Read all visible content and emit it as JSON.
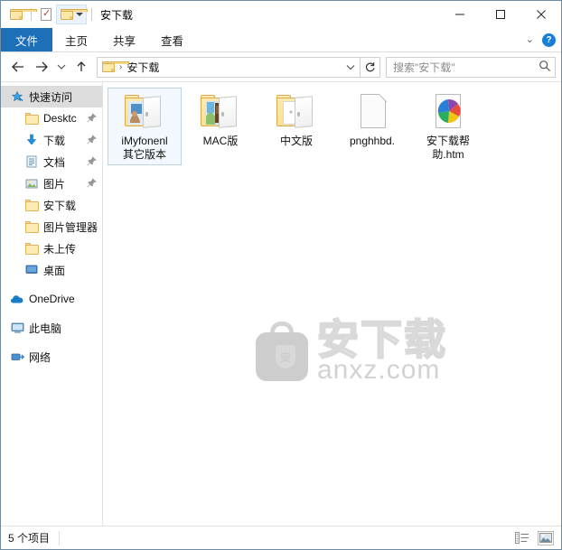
{
  "window": {
    "title": "安下载",
    "quick_access": [
      {
        "name": "folder-icon",
        "label": ""
      },
      {
        "name": "properties-icon",
        "label": ""
      },
      {
        "name": "new-folder-dropdown",
        "label": ""
      }
    ],
    "controls": {
      "minimize": "–",
      "maximize": "□",
      "close": "✕"
    }
  },
  "ribbon": {
    "tabs": [
      {
        "label": "文件",
        "active": true
      },
      {
        "label": "主页",
        "active": false
      },
      {
        "label": "共享",
        "active": false
      },
      {
        "label": "查看",
        "active": false
      }
    ],
    "expand_label": "⌄",
    "help_label": "?"
  },
  "address": {
    "back_title": "后退",
    "forward_title": "前进",
    "recent_title": "最近使用的位置",
    "up_title": "上移到",
    "breadcrumb": "安下载",
    "breadcrumb_sep": "›",
    "dropdown_label": "⌄",
    "refresh_label": "↻"
  },
  "search": {
    "placeholder": "搜索\"安下载\"",
    "icon": "search-icon"
  },
  "sidebar": {
    "items": [
      {
        "label": "快速访问",
        "icon": "star-pin-icon",
        "selected": true,
        "indent": false,
        "pinned": false
      },
      {
        "label": "Desktc",
        "icon": "folder-icon",
        "selected": false,
        "indent": true,
        "pinned": true
      },
      {
        "label": "下载",
        "icon": "download-icon",
        "selected": false,
        "indent": true,
        "pinned": true
      },
      {
        "label": "文档",
        "icon": "documents-icon",
        "selected": false,
        "indent": true,
        "pinned": true
      },
      {
        "label": "图片",
        "icon": "pictures-icon",
        "selected": false,
        "indent": true,
        "pinned": true
      },
      {
        "label": "安下载",
        "icon": "folder-icon",
        "selected": false,
        "indent": true,
        "pinned": false
      },
      {
        "label": "图片管理器",
        "icon": "folder-icon",
        "selected": false,
        "indent": true,
        "pinned": false
      },
      {
        "label": "未上传",
        "icon": "folder-icon",
        "selected": false,
        "indent": true,
        "pinned": false
      },
      {
        "label": "桌面",
        "icon": "desktop-icon",
        "selected": false,
        "indent": true,
        "pinned": false
      },
      {
        "label": "OneDrive",
        "icon": "onedrive-cloud-icon",
        "selected": false,
        "indent": false,
        "pinned": false
      },
      {
        "label": "此电脑",
        "icon": "this-pc-icon",
        "selected": false,
        "indent": false,
        "pinned": false
      },
      {
        "label": "网络",
        "icon": "network-icon",
        "selected": false,
        "indent": false,
        "pinned": false
      }
    ]
  },
  "files": [
    {
      "name": "iMyfonenl",
      "name2": "其它版本",
      "type": "folder-with-preview",
      "selected": true
    },
    {
      "name": "MAC版",
      "name2": "",
      "type": "folder-with-images",
      "selected": false
    },
    {
      "name": "中文版",
      "name2": "",
      "type": "folder-with-doc",
      "selected": false
    },
    {
      "name": "pnghhbd.",
      "name2": "",
      "type": "blank-document",
      "selected": false
    },
    {
      "name": "安下载帮",
      "name2": "助.htm",
      "type": "html-document",
      "selected": false
    }
  ],
  "watermark": {
    "cn_text": "安下载",
    "en_text": "anxz.com",
    "badge_char": "安"
  },
  "status": {
    "item_count": "5 个项目",
    "views": [
      {
        "name": "details-view-icon",
        "active": false
      },
      {
        "name": "large-icons-view-icon",
        "active": true
      }
    ]
  },
  "colors": {
    "accent": "#1d70b8",
    "folder": "#fde9b3",
    "selection_bg": "#f2f8fd",
    "selection_border": "#b8d6ea",
    "watermark_grey": "#d4d4d4"
  }
}
